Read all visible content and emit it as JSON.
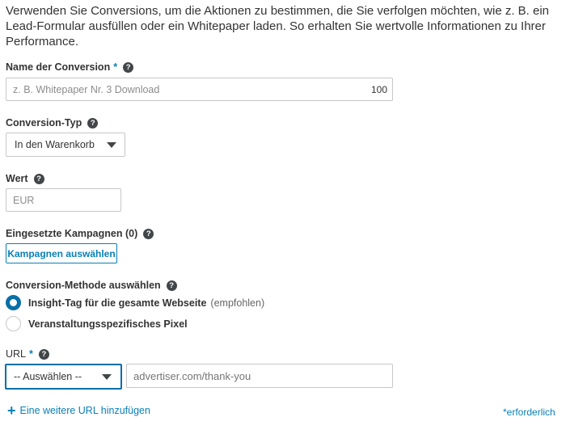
{
  "intro_text": "Verwenden Sie Conversions, um die Aktionen zu bestimmen, die Sie verfolgen möchten, wie z. B. ein Lead-Formular ausfüllen oder ein Whitepaper laden. So erhalten Sie wertvolle Informationen zu Ihrer Performance.",
  "name": {
    "label": "Name der Conversion",
    "required_mark": "*",
    "placeholder": "z. B. Whitepaper Nr. 3 Download",
    "char_counter": "100"
  },
  "conversion_type": {
    "label": "Conversion-Typ",
    "selected": "In den Warenkorb"
  },
  "value": {
    "label": "Wert",
    "placeholder": "EUR"
  },
  "campaigns": {
    "label": "Eingesetzte Kampagnen (0)",
    "button": "Kampagnen auswählen"
  },
  "method": {
    "label": "Conversion-Methode auswählen",
    "options": [
      {
        "label": "Insight-Tag für die gesamte Webseite",
        "note": "(empfohlen)",
        "selected": true
      },
      {
        "label": "Veranstaltungsspezifisches Pixel",
        "note": "",
        "selected": false
      }
    ]
  },
  "url": {
    "label": "URL",
    "required_mark": "*",
    "select_value": "-- Auswählen --",
    "input_placeholder": "advertiser.com/thank-you",
    "add_link": "Eine weitere URL hinzufügen"
  },
  "help_glyph": "?",
  "add_glyph": "+",
  "required_note": "*erforderlich",
  "colors": {
    "accent": "#0a7fb5",
    "text": "#333333",
    "border": "#c7c7c7"
  }
}
